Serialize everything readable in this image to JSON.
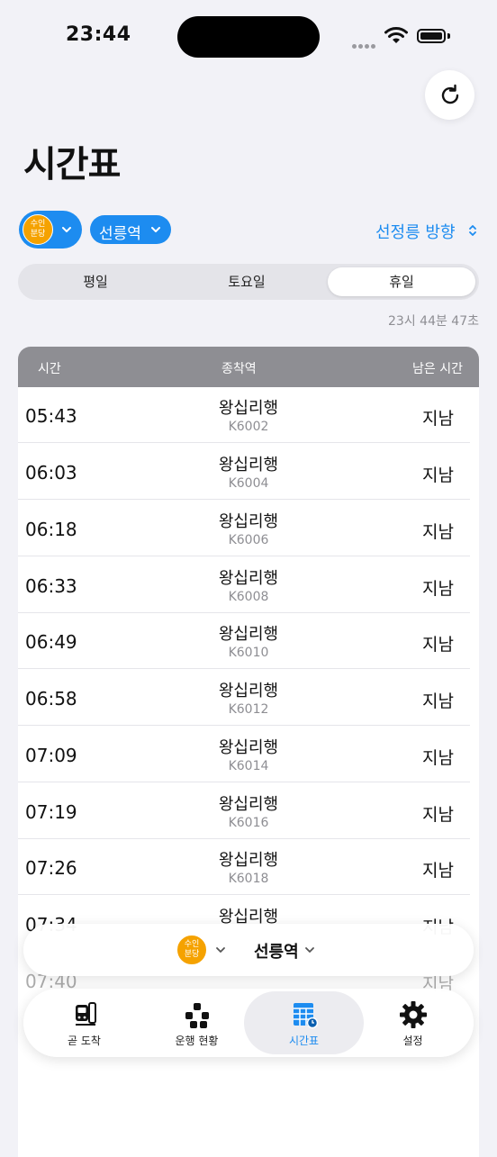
{
  "status_bar": {
    "time": "23:44"
  },
  "header": {
    "title": "시간표"
  },
  "selector": {
    "line_badge": "수인\n분당",
    "station": "선릉역",
    "direction": "선정릉 방향"
  },
  "day_tabs": [
    "평일",
    "토요일",
    "휴일"
  ],
  "selected_day": "휴일",
  "current_time": "23시 44분 47초",
  "table": {
    "headers": {
      "time": "시간",
      "destination": "종착역",
      "remaining": "남은 시간"
    },
    "rows": [
      {
        "time": "05:43",
        "destination": "왕십리행",
        "train": "K6002",
        "remaining": "지남"
      },
      {
        "time": "06:03",
        "destination": "왕십리행",
        "train": "K6004",
        "remaining": "지남"
      },
      {
        "time": "06:18",
        "destination": "왕십리행",
        "train": "K6006",
        "remaining": "지남"
      },
      {
        "time": "06:33",
        "destination": "왕십리행",
        "train": "K6008",
        "remaining": "지남"
      },
      {
        "time": "06:49",
        "destination": "왕십리행",
        "train": "K6010",
        "remaining": "지남"
      },
      {
        "time": "06:58",
        "destination": "왕십리행",
        "train": "K6012",
        "remaining": "지남"
      },
      {
        "time": "07:09",
        "destination": "왕십리행",
        "train": "K6014",
        "remaining": "지남"
      },
      {
        "time": "07:19",
        "destination": "왕십리행",
        "train": "K6016",
        "remaining": "지남"
      },
      {
        "time": "07:26",
        "destination": "왕십리행",
        "train": "K6018",
        "remaining": "지남"
      },
      {
        "time": "07:34",
        "destination": "왕십리행",
        "train": "",
        "remaining": "지남"
      },
      {
        "time": "07:40",
        "destination": "",
        "train": "",
        "remaining": "지남"
      }
    ]
  },
  "floating_station": {
    "line_badge": "수인\n분당",
    "station": "선릉역"
  },
  "tab_bar": [
    {
      "label": "곧 도착",
      "icon": "train-front-icon"
    },
    {
      "label": "운행 현황",
      "icon": "network-status-icon"
    },
    {
      "label": "시간표",
      "icon": "timetable-icon"
    },
    {
      "label": "설정",
      "icon": "gear-icon"
    }
  ],
  "active_tab": "시간표",
  "colors": {
    "accent": "#1d8cf0",
    "line_badge": "#f5a200",
    "header_row": "#8e8e93"
  }
}
